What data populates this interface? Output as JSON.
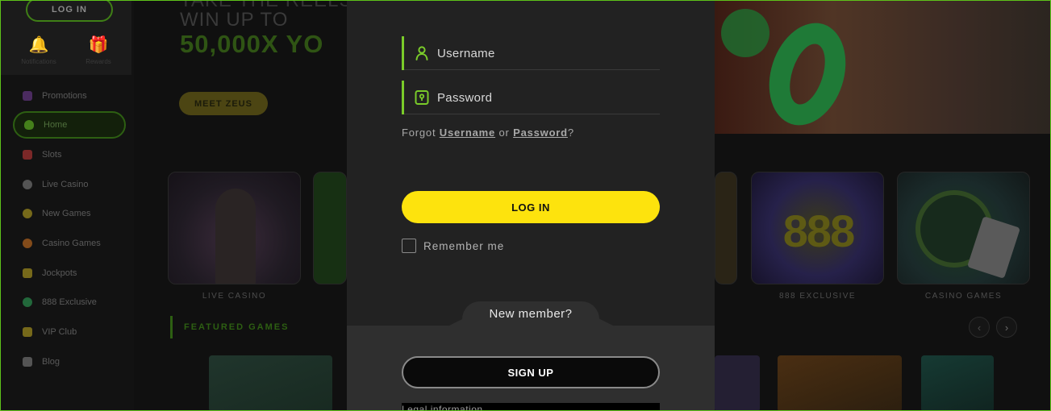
{
  "sidebar": {
    "login_label": "LOG IN",
    "tools": [
      {
        "label": "Notifications",
        "icon": "bell-icon"
      },
      {
        "label": "Rewards",
        "icon": "gift-icon"
      }
    ],
    "items": [
      {
        "label": "Promotions",
        "icon": "promotions-icon",
        "color": "#7a3fa0"
      },
      {
        "label": "Home",
        "icon": "heart-icon",
        "color": "#6fcf2a",
        "active": true
      },
      {
        "label": "Slots",
        "icon": "slots-icon",
        "color": "#d23b3b"
      },
      {
        "label": "Live Casino",
        "icon": "live-casino-icon",
        "color": "#8a8a8a"
      },
      {
        "label": "New Games",
        "icon": "new-games-icon",
        "color": "#c8b020"
      },
      {
        "label": "Casino Games",
        "icon": "casino-games-icon",
        "color": "#e07a20"
      },
      {
        "label": "Jockpots",
        "icon": "trophy-icon",
        "color": "#c8b020"
      },
      {
        "label": "888 Exclusive",
        "icon": "888-icon",
        "color": "#2fae5c"
      },
      {
        "label": "VIP Club",
        "icon": "vip-icon",
        "color": "#c8b020"
      },
      {
        "label": "Blog",
        "icon": "blog-icon",
        "color": "#8a8a8a"
      }
    ]
  },
  "hero": {
    "line1": "TAKE THE REELS",
    "line2": "WIN UP TO",
    "line3": "50,000X YO",
    "cta": "MEET ZEUS"
  },
  "tiles": [
    {
      "label": "LIVE CASINO"
    },
    {
      "label": "888 EXCLUSIVE",
      "art_text": "888"
    },
    {
      "label": "CASINO GAMES"
    }
  ],
  "featured": {
    "label": "FEATURED GAMES",
    "prev_icon": "chevron-left-icon",
    "next_icon": "chevron-right-icon",
    "prev_glyph": "‹",
    "next_glyph": "›"
  },
  "modal": {
    "username_placeholder": "Username",
    "password_placeholder": "Password",
    "forgot_prefix": "Forgot",
    "forgot_username": "Username",
    "forgot_or": "or",
    "forgot_password": "Password",
    "forgot_suffix": "?",
    "login_button": "LOG IN",
    "remember_label": "Remember me",
    "remember_checked": false,
    "new_member": "New member?",
    "signup_button": "SIGN UP",
    "legal": "Legal information",
    "accent_color": "#7acb2a",
    "login_button_color": "#fde30d"
  }
}
